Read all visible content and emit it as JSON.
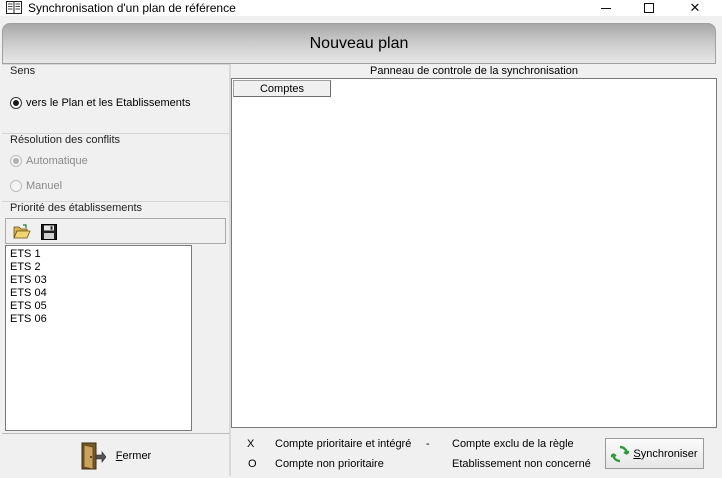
{
  "window": {
    "title": "Synchronisation d'un plan de référence",
    "minimize_icon": "minimize-icon",
    "maximize_icon": "maximize-icon",
    "close_icon": "close-icon",
    "close_glyph": "✕"
  },
  "header": {
    "title": "Nouveau plan"
  },
  "left": {
    "sens": {
      "title": "Sens",
      "option": "vers le Plan et les Etablissements",
      "checked": true
    },
    "conflits": {
      "title": "Résolution des conflits",
      "options": [
        {
          "label": "Automatique",
          "checked": true,
          "disabled": true
        },
        {
          "label": "Manuel",
          "checked": false,
          "disabled": true
        }
      ]
    },
    "priorite": {
      "title": "Priorité des établissements",
      "items": [
        "ETS 1",
        "ETS 2",
        "ETS 03",
        "ETS 04",
        "ETS 05",
        "ETS 06"
      ]
    },
    "fermer": {
      "label_first": "F",
      "label_rest": "ermer"
    }
  },
  "right": {
    "caption": "Panneau de controle de la synchronisation",
    "column_header": "Comptes",
    "legend": {
      "x_symbol": "X",
      "x_text": "Compte prioritaire et intégré",
      "dash_symbol": "-",
      "dash_text": "Compte exclu de la règle",
      "o_symbol": "O",
      "o_text": "Compte non prioritaire",
      "etab_text": "Etablissement non concerné"
    },
    "sync_button": {
      "label_first": "S",
      "label_rest": "ynchroniser"
    }
  },
  "colors": {
    "banner_top": "#a8a8a8",
    "banner_bottom": "#e7e7e7",
    "sync_icon_green": "#2e9a3a"
  }
}
